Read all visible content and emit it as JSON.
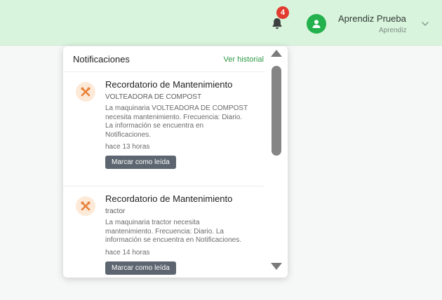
{
  "header": {
    "notifications_count": "4",
    "user_name": "Aprendiz Prueba",
    "user_role": "Aprendiz"
  },
  "panel": {
    "title": "Notificaciones",
    "history_link": "Ver historial",
    "items": [
      {
        "title": "Recordatorio de Mantenimiento",
        "subtitle": "VOLTEADORA DE COMPOST",
        "text": "La maquinaria VOLTEADORA DE COMPOST necesita mantenimiento. Frecuencia: Diario. La información se encuentra en Notificaciones.",
        "time": "hace 13 horas",
        "action": "Marcar como leída"
      },
      {
        "title": "Recordatorio de Mantenimiento",
        "subtitle": "tractor",
        "text": "La maquinaria tractor necesita mantenimiento. Frecuencia: Diario. La información se encuentra en Notificaciones.",
        "time": "hace 14 horas",
        "action": "Marcar como leída"
      }
    ]
  },
  "colors": {
    "topbar": "#d9f4dc",
    "accent_green": "#22b14c",
    "link_green": "#2f9a45",
    "badge_red": "#e23b2f",
    "button_gray": "#5d6670",
    "icon_orange": "#e8823a"
  },
  "icons": {
    "bell": "bell-icon",
    "avatar": "user-avatar-icon",
    "chevron": "chevron-down-icon",
    "notification": "tools-icon"
  }
}
